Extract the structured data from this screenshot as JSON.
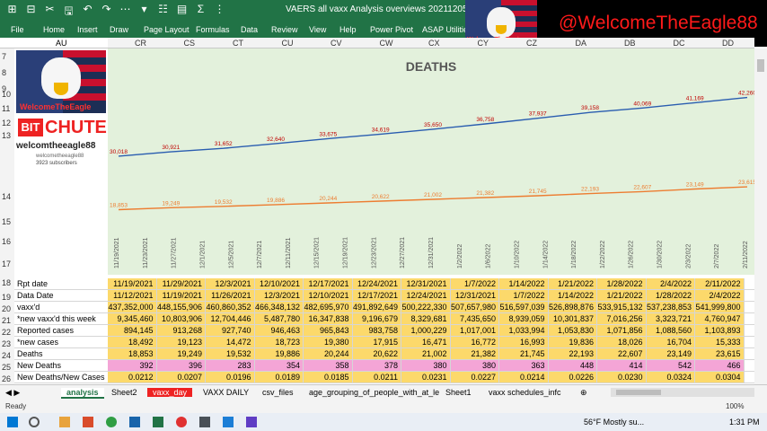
{
  "window": {
    "title": "VAERS all vaxx Analysis overviews 20211205 (Recovered)"
  },
  "quick_access": [
    "⊞",
    "⊟",
    "✂",
    "🖫",
    "↶",
    "↷",
    "⋯",
    "▾",
    "☷",
    "▤",
    "Σ",
    "⋮"
  ],
  "ribbon_tabs": [
    "File",
    "Home",
    "Insert",
    "Draw",
    "Page Layout",
    "Formulas",
    "Data",
    "Review",
    "View",
    "Help",
    "Power Pivot",
    "ASAP Utilities"
  ],
  "branding": {
    "handle": "@WelcomeTheEagle88",
    "logo_text": "WelcomeTheEagle",
    "bitchute_bit": "BIT",
    "bitchute_chute": "CHUTE",
    "channel": "welcomtheeagle88",
    "channel_small": "welcometheeagle88",
    "subscribers": "3923 subscribers"
  },
  "namebox": {
    "value": "AU"
  },
  "column_headers": [
    "CR",
    "CS",
    "CT",
    "CU",
    "CV",
    "CW",
    "CX",
    "CY",
    "CZ",
    "DA",
    "DB",
    "DC",
    "DD"
  ],
  "row_numbers": [
    "7",
    "8",
    "9",
    "10",
    "11",
    "12",
    "13",
    "14",
    "15",
    "16",
    "17",
    "18",
    "19",
    "20",
    "21",
    "22",
    "23",
    "24",
    "25",
    "26"
  ],
  "chart_data": {
    "type": "line",
    "title": "DEATHS",
    "series": [
      {
        "values": [
          30018,
          30921,
          31652,
          32640,
          33675,
          34619,
          35650,
          36758,
          37937,
          39158,
          40069,
          41169,
          42260
        ]
      },
      {
        "values": [
          18853,
          19249,
          19532,
          19886,
          20244,
          20622,
          21002,
          21382,
          21745,
          22193,
          22607,
          23149,
          23615
        ]
      }
    ],
    "series_colors": [
      "#2a5db0",
      "#ed7d31"
    ],
    "label_colors": [
      "#c00000",
      "#ed7d31"
    ],
    "x": [
      "11/19/2021",
      "11/23/2021",
      "11/27/2021",
      "12/1/2021",
      "12/5/2021",
      "12/7/2021",
      "12/11/2021",
      "12/15/2021",
      "12/19/2021",
      "12/23/2021",
      "12/27/2021",
      "12/31/2021",
      "1/2/2022",
      "1/6/2022",
      "1/10/2022",
      "1/14/2022",
      "1/18/2022",
      "1/22/2022",
      "1/26/2022",
      "1/30/2022",
      "2/3/2022",
      "2/7/2022",
      "2/11/2022"
    ],
    "xlabel": "",
    "ylabel": "",
    "grid": false,
    "background": "#e3f1dc"
  },
  "table": {
    "rows": [
      {
        "label": "Rpt date",
        "style": "yellow",
        "cells": [
          "11/19/2021",
          "11/29/2021",
          "12/3/2021",
          "12/10/2021",
          "12/17/2021",
          "12/24/2021",
          "12/31/2021",
          "1/7/2022",
          "1/14/2022",
          "1/21/2022",
          "1/28/2022",
          "2/4/2022",
          "2/11/2022"
        ]
      },
      {
        "label": "Data Date",
        "style": "yellow",
        "cells": [
          "11/12/2021",
          "11/19/2021",
          "11/26/2021",
          "12/3/2021",
          "12/10/2021",
          "12/17/2021",
          "12/24/2021",
          "12/31/2021",
          "1/7/2022",
          "1/14/2022",
          "1/21/2022",
          "1/28/2022",
          "2/4/2022"
        ]
      },
      {
        "label": "vaxx'd",
        "style": "yellow",
        "cells": [
          "437,352,000",
          "448,155,906",
          "460,860,352",
          "466,348,132",
          "482,695,970",
          "491,892,649",
          "500,222,330",
          "507,657,980",
          "516,597,039",
          "526,898,876",
          "533,915,132",
          "537,238,853",
          "541,999,800"
        ]
      },
      {
        "label": "*new vaxx'd this week",
        "style": "yellow",
        "cells": [
          "9,345,460",
          "10,803,906",
          "12,704,446",
          "5,487,780",
          "16,347,838",
          "9,196,679",
          "8,329,681",
          "7,435,650",
          "8,939,059",
          "10,301,837",
          "7,016,256",
          "3,323,721",
          "4,760,947"
        ]
      },
      {
        "label": "Reported cases",
        "style": "yellow",
        "cells": [
          "894,145",
          "913,268",
          "927,740",
          "946,463",
          "965,843",
          "983,758",
          "1,000,229",
          "1,017,001",
          "1,033,994",
          "1,053,830",
          "1,071,856",
          "1,088,560",
          "1,103,893"
        ]
      },
      {
        "label": "*new cases",
        "style": "yellow",
        "cells": [
          "18,492",
          "19,123",
          "14,472",
          "18,723",
          "19,380",
          "17,915",
          "16,471",
          "16,772",
          "16,993",
          "19,836",
          "18,026",
          "16,704",
          "15,333"
        ]
      },
      {
        "label": "Deaths",
        "style": "yellow",
        "cells": [
          "18,853",
          "19,249",
          "19,532",
          "19,886",
          "20,244",
          "20,622",
          "21,002",
          "21,382",
          "21,745",
          "22,193",
          "22,607",
          "23,149",
          "23,615"
        ]
      },
      {
        "label": "New Deaths",
        "style": "pink",
        "cells": [
          "392",
          "396",
          "283",
          "354",
          "358",
          "378",
          "380",
          "380",
          "363",
          "448",
          "414",
          "542",
          "466"
        ]
      },
      {
        "label": "New Deaths/New Cases",
        "style": "yellow",
        "cells": [
          "0.0212",
          "0.0207",
          "0.0196",
          "0.0189",
          "0.0185",
          "0.0211",
          "0.0231",
          "0.0227",
          "0.0214",
          "0.0226",
          "0.0230",
          "0.0324",
          "0.0304"
        ]
      }
    ]
  },
  "sheet_tabs": [
    "analysis",
    "Sheet2",
    "vaxx_day",
    "VAXX DAILY",
    "csv_files",
    "age_grouping_of_people_with_at_le",
    "Sheet1",
    "vaxx schedules_infc"
  ],
  "status": {
    "ready": "Ready",
    "weather": "56°F  Mostly su...",
    "time": "1:31 PM",
    "zoom": "100%"
  }
}
